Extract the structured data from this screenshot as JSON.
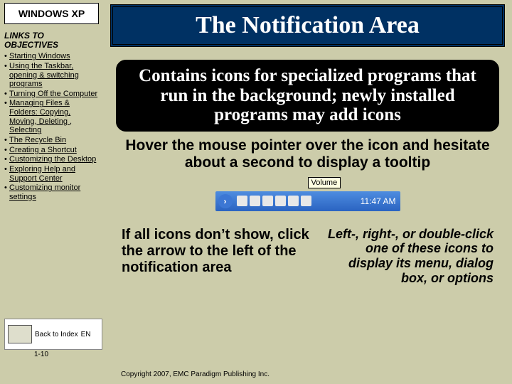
{
  "sidebar": {
    "os": "WINDOWS XP",
    "links_heading": "LINKS TO OBJECTIVES",
    "items": [
      "Starting Windows",
      "Using the Taskbar, opening & switching programs",
      "Turning Off the Computer",
      "Managing Files & Folders: Copying, Moving, Deleting , Selecting",
      "The Recycle Bin",
      "Creating a Shortcut",
      "Customizing the Desktop",
      "Exploring Help and Support Center",
      "Customizing monitor settings"
    ]
  },
  "title": "The Notification Area",
  "lead": "Contains icons for specialized programs that run in the background;\nnewly installed programs may add icons",
  "hover": "Hover the mouse pointer over the icon and hesitate about a second to display a tooltip",
  "tray": {
    "tooltip": "Volume",
    "time": "11:47 AM"
  },
  "lower_left": "If all icons don’t show, click the arrow to the left of the notification area",
  "lower_right": "Left-, right-, or double-click one of these icons to display its menu, dialog box, or options",
  "footer": {
    "label1": "Back to Index",
    "label2": "EN",
    "slide_num": "1-10"
  },
  "copyright": "Copyright 2007, EMC Paradigm Publishing Inc."
}
